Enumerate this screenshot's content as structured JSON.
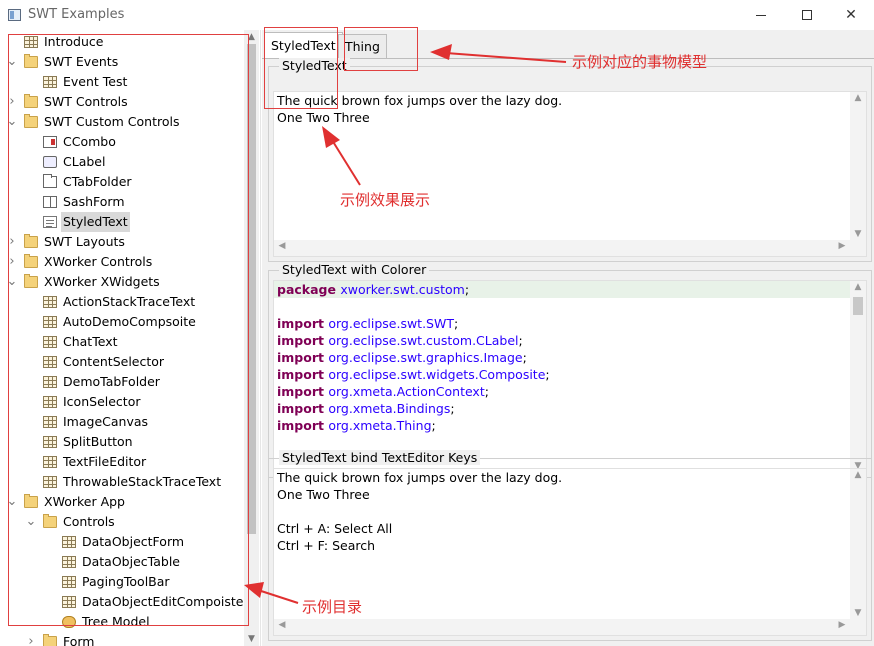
{
  "window": {
    "title": "SWT Examples",
    "icon": "swt-app-icon"
  },
  "tree": [
    {
      "label": "Introduce",
      "icon": "table-icon",
      "level": 0,
      "twisty": ""
    },
    {
      "label": "SWT Events",
      "icon": "folder-icon",
      "level": 0,
      "twisty": "open"
    },
    {
      "label": "Event Test",
      "icon": "table-icon",
      "level": 1,
      "twisty": ""
    },
    {
      "label": "SWT Controls",
      "icon": "folder-icon",
      "level": 0,
      "twisty": "closed"
    },
    {
      "label": "SWT Custom Controls",
      "icon": "folder-icon",
      "level": 0,
      "twisty": "open"
    },
    {
      "label": "CCombo",
      "icon": "ccombo-icon",
      "level": 1,
      "twisty": ""
    },
    {
      "label": "CLabel",
      "icon": "clabel-icon",
      "level": 1,
      "twisty": ""
    },
    {
      "label": "CTabFolder",
      "icon": "ctabfolder-icon",
      "level": 1,
      "twisty": ""
    },
    {
      "label": "SashForm",
      "icon": "sashform-icon",
      "level": 1,
      "twisty": ""
    },
    {
      "label": "StyledText",
      "icon": "styledtext-icon",
      "level": 1,
      "twisty": "",
      "selected": true
    },
    {
      "label": "SWT Layouts",
      "icon": "folder-icon",
      "level": 0,
      "twisty": "closed"
    },
    {
      "label": "XWorker Controls",
      "icon": "folder-icon",
      "level": 0,
      "twisty": "closed"
    },
    {
      "label": "XWorker XWidgets",
      "icon": "folder-icon",
      "level": 0,
      "twisty": "open"
    },
    {
      "label": "ActionStackTraceText",
      "icon": "table-icon",
      "level": 1,
      "twisty": ""
    },
    {
      "label": "AutoDemoCompsoite",
      "icon": "table-icon",
      "level": 1,
      "twisty": ""
    },
    {
      "label": "ChatText",
      "icon": "table-icon",
      "level": 1,
      "twisty": ""
    },
    {
      "label": "ContentSelector",
      "icon": "table-icon",
      "level": 1,
      "twisty": ""
    },
    {
      "label": "DemoTabFolder",
      "icon": "table-icon",
      "level": 1,
      "twisty": ""
    },
    {
      "label": "IconSelector",
      "icon": "table-icon",
      "level": 1,
      "twisty": ""
    },
    {
      "label": "ImageCanvas",
      "icon": "table-icon",
      "level": 1,
      "twisty": ""
    },
    {
      "label": "SplitButton",
      "icon": "table-icon",
      "level": 1,
      "twisty": ""
    },
    {
      "label": "TextFileEditor",
      "icon": "table-icon",
      "level": 1,
      "twisty": ""
    },
    {
      "label": "ThrowableStackTraceText",
      "icon": "table-icon",
      "level": 1,
      "twisty": ""
    },
    {
      "label": "XWorker App",
      "icon": "folder-icon",
      "level": 0,
      "twisty": "open"
    },
    {
      "label": "Controls",
      "icon": "folder-icon",
      "level": 1,
      "twisty": "open"
    },
    {
      "label": "DataObjectForm",
      "icon": "table-icon",
      "level": 2,
      "twisty": ""
    },
    {
      "label": "DataObjecTable",
      "icon": "table-icon",
      "level": 2,
      "twisty": ""
    },
    {
      "label": "PagingToolBar",
      "icon": "table-icon",
      "level": 2,
      "twisty": ""
    },
    {
      "label": "DataObjectEditCompoiste",
      "icon": "table-icon",
      "level": 2,
      "twisty": ""
    },
    {
      "label": "Tree Model",
      "icon": "tree-model-icon",
      "level": 2,
      "twisty": ""
    },
    {
      "label": "Form",
      "icon": "folder-icon",
      "level": 1,
      "twisty": "closed"
    }
  ],
  "tabs": [
    {
      "label": "StyledText",
      "active": true
    },
    {
      "label": "Thing",
      "active": false
    }
  ],
  "groups": {
    "g1": {
      "title": "StyledText",
      "lines": [
        "The quick brown fox jumps over the lazy dog.",
        "One Two Three"
      ]
    },
    "g2": {
      "title": "StyledText with Colorer",
      "code": [
        [
          {
            "t": "package ",
            "c": "kw"
          },
          {
            "t": "xworker.swt.custom",
            "c": "pkg"
          },
          {
            "t": ";",
            "c": ""
          }
        ],
        [],
        [
          {
            "t": "import ",
            "c": "kw"
          },
          {
            "t": "org.eclipse.swt.SWT",
            "c": "pkg"
          },
          {
            "t": ";",
            "c": ""
          }
        ],
        [
          {
            "t": "import ",
            "c": "kw"
          },
          {
            "t": "org.eclipse.swt.custom.CLabel",
            "c": "pkg"
          },
          {
            "t": ";",
            "c": ""
          }
        ],
        [
          {
            "t": "import ",
            "c": "kw"
          },
          {
            "t": "org.eclipse.swt.graphics.Image",
            "c": "pkg"
          },
          {
            "t": ";",
            "c": ""
          }
        ],
        [
          {
            "t": "import ",
            "c": "kw"
          },
          {
            "t": "org.eclipse.swt.widgets.Composite",
            "c": "pkg"
          },
          {
            "t": ";",
            "c": ""
          }
        ],
        [
          {
            "t": "import ",
            "c": "kw"
          },
          {
            "t": "org.xmeta.ActionContext",
            "c": "pkg"
          },
          {
            "t": ";",
            "c": ""
          }
        ],
        [
          {
            "t": "import ",
            "c": "kw"
          },
          {
            "t": "org.xmeta.Bindings",
            "c": "pkg"
          },
          {
            "t": ";",
            "c": ""
          }
        ],
        [
          {
            "t": "import ",
            "c": "kw"
          },
          {
            "t": "org.xmeta.Thing",
            "c": "pkg"
          },
          {
            "t": ";",
            "c": ""
          }
        ]
      ]
    },
    "g3": {
      "title": "StyledText bind TextEditor Keys",
      "lines": [
        "The quick brown fox jumps over the lazy dog.",
        "One Two Three",
        "",
        "Ctrl + A: Select All",
        "Ctrl + F: Search"
      ]
    }
  },
  "annotations": {
    "model": "示例对应的事物模型",
    "effect": "示例效果展示",
    "catalog": "示例目录"
  },
  "colors": {
    "annotation": "#e03030",
    "keyword": "#7f0055",
    "package": "#2a00ff"
  }
}
